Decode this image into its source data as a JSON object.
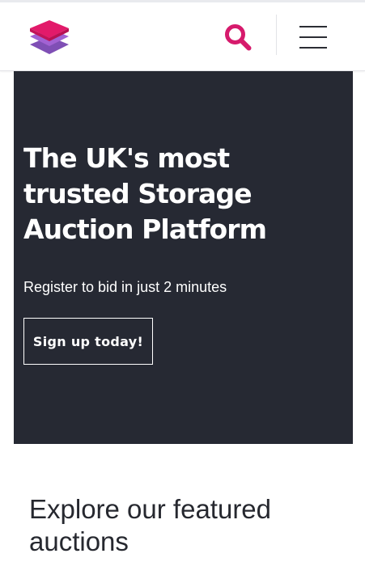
{
  "header": {
    "logo_icon": "stacked-layers-logo",
    "search_icon": "search-icon",
    "menu_icon": "hamburger-menu-icon",
    "accent_color": "#d61a6c"
  },
  "hero": {
    "title": "The UK's most trusted Storage Auction Platform",
    "subtitle": "Register to bid in just 2 minutes",
    "cta_label": "Sign up today!",
    "background_color": "#262933"
  },
  "featured": {
    "title": "Explore our featured auctions"
  }
}
